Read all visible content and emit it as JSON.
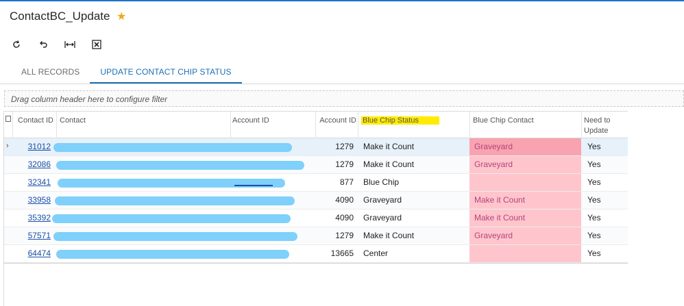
{
  "window": {
    "title": "ContactBC_Update"
  },
  "toolbar": {
    "icons": [
      "refresh-icon",
      "undo-icon",
      "fit-columns-icon",
      "export-excel-icon"
    ]
  },
  "tabs": [
    {
      "label": "ALL RECORDS",
      "active": false
    },
    {
      "label": "UPDATE CONTACT CHIP STATUS",
      "active": true
    }
  ],
  "filter": {
    "placeholder": "Drag column header here to configure filter"
  },
  "grid": {
    "headers": {
      "contact_id": "Contact ID",
      "contact": "Contact",
      "account_id": "Account ID",
      "account_id2": "Account ID",
      "blue_chip_status": "Blue Chip Status",
      "blue_chip_contact": "Blue Chip Contact",
      "need_to_update": "Need to Update"
    },
    "rows": [
      {
        "contact_id": "31012",
        "account_id": "1279",
        "blue_chip_status": "Make it Count",
        "blue_chip_contact": "Graveyard",
        "need_to_update": "Yes"
      },
      {
        "contact_id": "32086",
        "account_id": "1279",
        "blue_chip_status": "Make it Count",
        "blue_chip_contact": "Graveyard",
        "need_to_update": "Yes"
      },
      {
        "contact_id": "32341",
        "account_id": "877",
        "blue_chip_status": "Blue Chip",
        "blue_chip_contact": "",
        "need_to_update": "Yes"
      },
      {
        "contact_id": "33958",
        "account_id": "4090",
        "blue_chip_status": "Graveyard",
        "blue_chip_contact": "Make it Count",
        "need_to_update": "Yes"
      },
      {
        "contact_id": "35392",
        "account_id": "4090",
        "blue_chip_status": "Graveyard",
        "blue_chip_contact": "Make it Count",
        "need_to_update": "Yes"
      },
      {
        "contact_id": "57571",
        "account_id": "1279",
        "blue_chip_status": "Make it Count",
        "blue_chip_contact": "Graveyard",
        "need_to_update": "Yes"
      },
      {
        "contact_id": "64474",
        "account_id": "13665",
        "blue_chip_status": "Center",
        "blue_chip_contact": "",
        "need_to_update": "Yes"
      }
    ]
  },
  "colors": {
    "accent": "#1a6fb6",
    "highlight": "#ffeb00",
    "mismatch": "#ffc5cd",
    "redacted": "#7fd0fb"
  }
}
